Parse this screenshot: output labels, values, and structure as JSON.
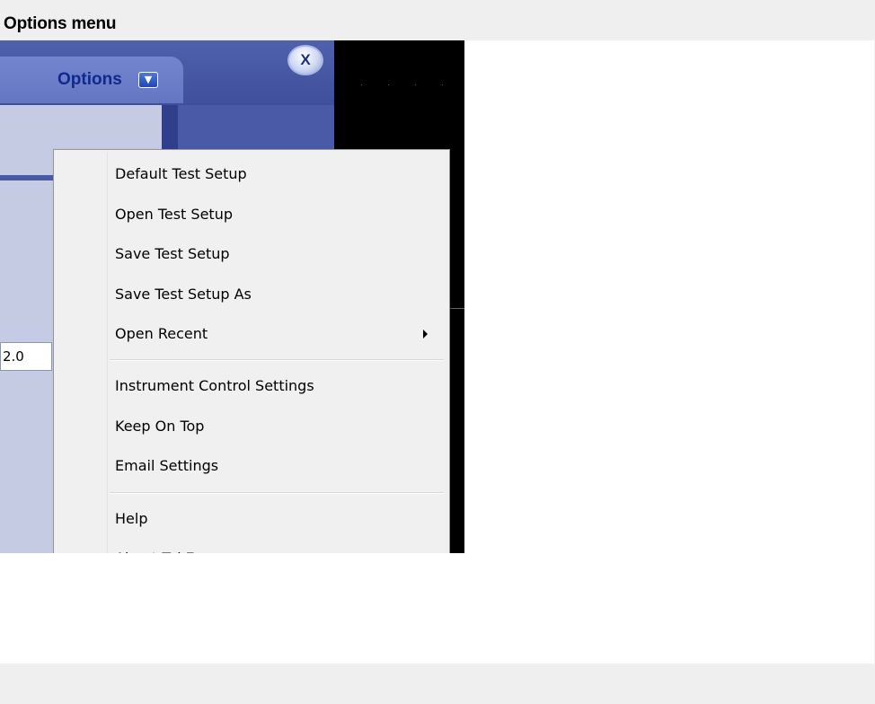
{
  "caption": "Options menu",
  "app": {
    "options_label": "Options",
    "options_arrow_icon": "triangle-down",
    "close_label": "X",
    "value_field": "2.0"
  },
  "menu": {
    "items": [
      {
        "label": "Default Test Setup"
      },
      {
        "label": "Open Test Setup"
      },
      {
        "label": "Save Test Setup"
      },
      {
        "label": "Save Test Setup As"
      },
      {
        "label": "Open Recent",
        "has_submenu": true
      },
      {
        "label": "Instrument Control Settings"
      },
      {
        "label": "Keep On Top"
      },
      {
        "label": "Email Settings"
      },
      {
        "label": "Help"
      },
      {
        "label": "About TekExpress"
      }
    ]
  },
  "colors": {
    "header": "#4f60ac",
    "options_text": "#0f2a8c",
    "menu_bg": "#f0f0f0"
  }
}
